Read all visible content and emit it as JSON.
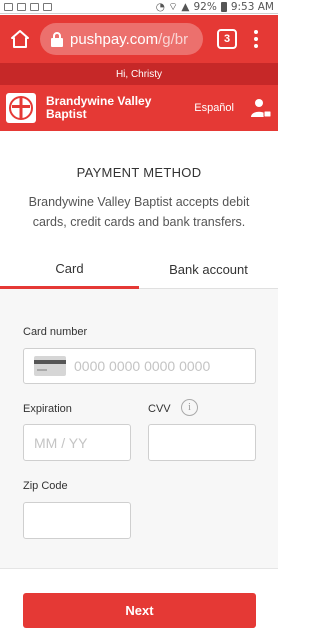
{
  "status_bar": {
    "battery": "92%",
    "time": "9:53 AM"
  },
  "browser": {
    "url_host": "pushpay.com",
    "url_path": "/g/br",
    "tab_count": "3"
  },
  "greeting": "Hi, Christy",
  "header": {
    "org_name": "Brandywine Valley Baptist",
    "language_link": "Español"
  },
  "payment": {
    "title": "PAYMENT METHOD",
    "description": "Brandywine Valley Baptist accepts debit cards, credit cards and bank transfers.",
    "tabs": [
      "Card",
      "Bank account"
    ],
    "active_tab": "Card"
  },
  "form": {
    "card_number_label": "Card number",
    "card_number_placeholder": "0000 0000 0000 0000",
    "expiration_label": "Expiration",
    "expiration_placeholder": "MM / YY",
    "cvv_label": "CVV",
    "zip_label": "Zip Code"
  },
  "next_button": "Next",
  "colors": {
    "brand_red": "#e53935",
    "brand_dark_red": "#c62828"
  }
}
